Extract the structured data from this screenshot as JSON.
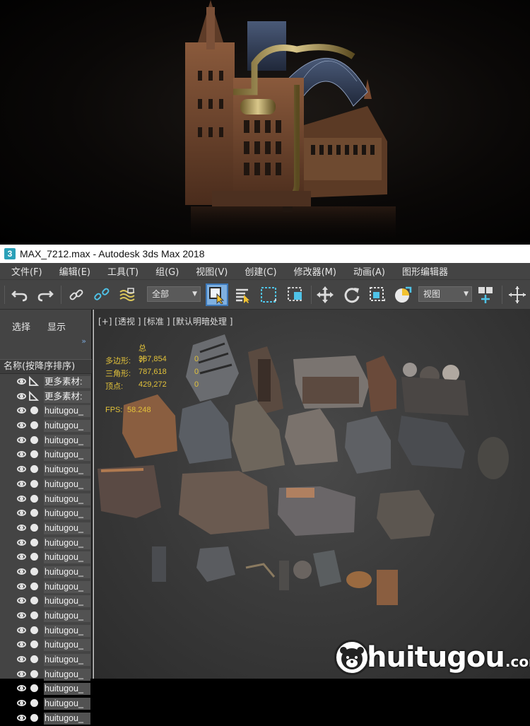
{
  "window": {
    "title": "MAX_7212.max - Autodesk 3ds Max 2018",
    "app_icon_glyph": "3"
  },
  "menu": [
    {
      "label": "文件(F)"
    },
    {
      "label": "编辑(E)"
    },
    {
      "label": "工具(T)"
    },
    {
      "label": "组(G)"
    },
    {
      "label": "视图(V)"
    },
    {
      "label": "创建(C)"
    },
    {
      "label": "修改器(M)"
    },
    {
      "label": "动画(A)"
    },
    {
      "label": "图形编辑器"
    }
  ],
  "toolbar": {
    "selection_filter": "全部",
    "reference_coord": "视图",
    "icons": [
      "undo-icon",
      "redo-icon",
      "link-icon",
      "unlink-icon",
      "bind-spacewarp-icon",
      "select-object-icon",
      "select-by-name-icon",
      "rectangular-selection-icon",
      "window-crossing-icon",
      "move-icon",
      "rotate-icon",
      "scale-icon",
      "placement-icon",
      "pivot-icon",
      "snap-icon"
    ]
  },
  "scene_explorer": {
    "tabs": [
      "选择",
      "显示"
    ],
    "more_indicator": "»",
    "column_header": "名称(按降序排序)",
    "rows": [
      {
        "label": "更多素材:",
        "type": "triangle"
      },
      {
        "label": "更多素材:",
        "type": "triangle"
      },
      {
        "label": "huitugou_",
        "type": "dot"
      },
      {
        "label": "huitugou_",
        "type": "dot"
      },
      {
        "label": "huitugou_",
        "type": "dot"
      },
      {
        "label": "huitugou_",
        "type": "dot"
      },
      {
        "label": "huitugou_",
        "type": "dot"
      },
      {
        "label": "huitugou_",
        "type": "dot"
      },
      {
        "label": "huitugou_",
        "type": "dot"
      },
      {
        "label": "huitugou_",
        "type": "dot"
      },
      {
        "label": "huitugou_",
        "type": "dot"
      },
      {
        "label": "huitugou_",
        "type": "dot"
      },
      {
        "label": "huitugou_",
        "type": "dot"
      },
      {
        "label": "huitugou_",
        "type": "dot"
      },
      {
        "label": "huitugou_",
        "type": "dot"
      },
      {
        "label": "huitugou_",
        "type": "dot"
      },
      {
        "label": "huitugou_",
        "type": "dot"
      },
      {
        "label": "huitugou_",
        "type": "dot"
      },
      {
        "label": "huitugou_",
        "type": "dot"
      },
      {
        "label": "huitugou_",
        "type": "dot"
      },
      {
        "label": "huitugou_",
        "type": "dot"
      },
      {
        "label": "huitugou_",
        "type": "dot"
      },
      {
        "label": "huitugou_",
        "type": "dot"
      },
      {
        "label": "huitugou_",
        "type": "dot"
      }
    ]
  },
  "viewport": {
    "label": "[+] [透视 ] [标准 ] [默认明暗处理 ]",
    "stats": {
      "header": "总计",
      "polys_label": "多边形:",
      "polys_value": "387,854",
      "polys_sel": "0",
      "tris_label": "三角形:",
      "tris_value": "787,618",
      "tris_sel": "0",
      "verts_label": "顶点:",
      "verts_value": "429,272",
      "verts_sel": "0",
      "fps_label": "FPS:",
      "fps_value": "58.248"
    }
  },
  "watermark": {
    "word": "huitugou",
    "suffix": ".com"
  },
  "colors": {
    "ui_bg": "#444444",
    "viewport_bg": "#3b3b3b",
    "stats_text": "#e2c23a",
    "active_tool": "#5b9bd5"
  }
}
